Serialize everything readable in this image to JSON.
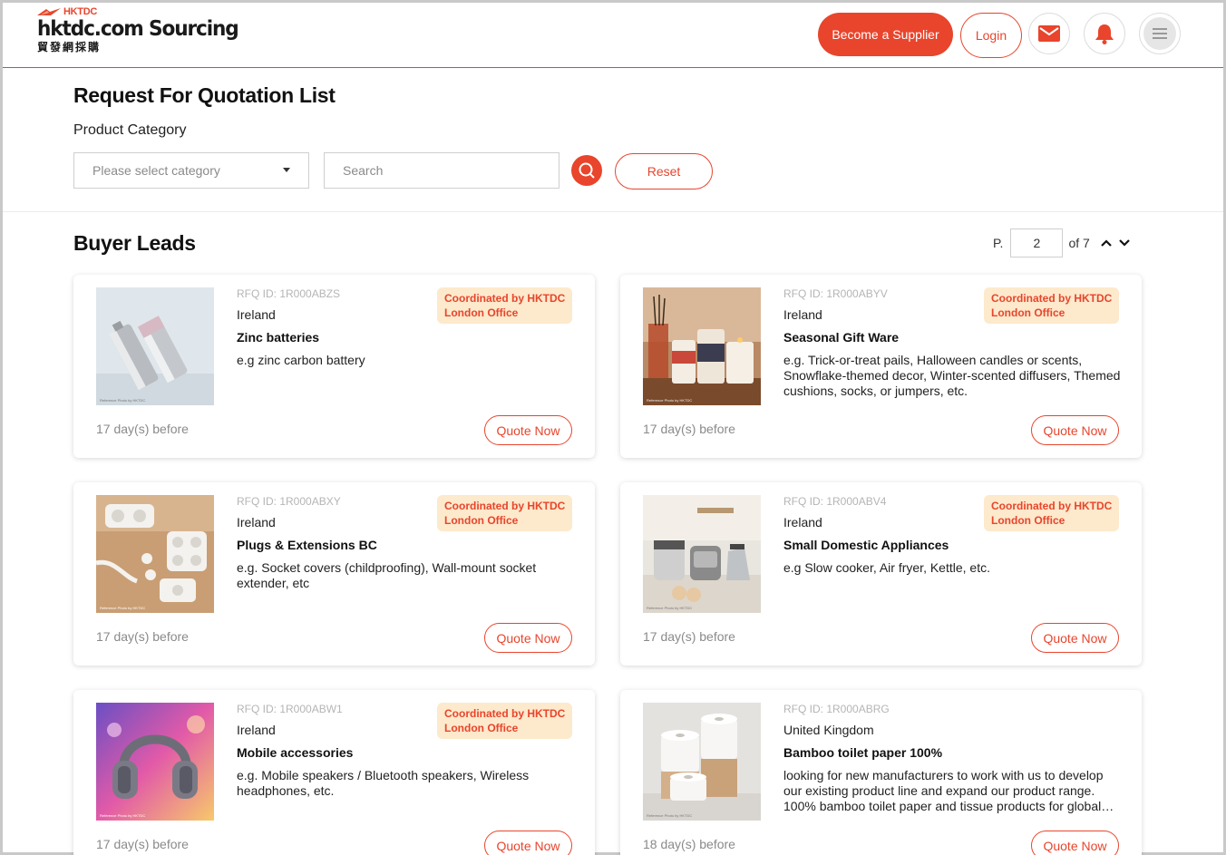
{
  "header": {
    "logo_small": "HKTDC",
    "logo_main": "hktdc.com Sourcing",
    "logo_sub": "貿發網採購",
    "become_supplier_label": "Become a Supplier",
    "login_label": "Login",
    "icons": [
      "mail-icon",
      "bell-icon",
      "menu-icon"
    ]
  },
  "filters": {
    "page_title": "Request For Quotation List",
    "category_label": "Product Category",
    "category_placeholder": "Please select category",
    "search_placeholder": "Search",
    "reset_label": "Reset"
  },
  "leads": {
    "section_title": "Buyer Leads",
    "pager": {
      "prefix": "P.",
      "current": "2",
      "of_text": "of 7"
    },
    "items": [
      {
        "rfq_id": "RFQ ID: 1R000ABZS",
        "country": "Ireland",
        "title": "Zinc batteries",
        "description": "e.g zinc carbon battery",
        "badge_line1": "Coordinated by HKTDC",
        "badge_line2": "London Office",
        "age": "17 day(s) before",
        "quote_label": "Quote Now",
        "image": "battery-photo"
      },
      {
        "rfq_id": "RFQ ID: 1R000ABYV",
        "country": "Ireland",
        "title": "Seasonal Gift Ware",
        "description": "e.g. Trick-or-treat pails, Halloween candles or scents, Snowflake-themed decor, Winter-scented diffusers, Themed cushions, socks, or jumpers, etc.",
        "badge_line1": "Coordinated by HKTDC",
        "badge_line2": "London Office",
        "age": "17 day(s) before",
        "quote_label": "Quote Now",
        "image": "candles-photo"
      },
      {
        "rfq_id": "RFQ ID: 1R000ABXY",
        "country": "Ireland",
        "title": "Plugs & Extensions BC",
        "description": "e.g. Socket covers (childproofing), Wall-mount socket extender, etc",
        "badge_line1": "Coordinated by HKTDC",
        "badge_line2": "London Office",
        "age": "17 day(s) before",
        "quote_label": "Quote Now",
        "image": "plugs-photo"
      },
      {
        "rfq_id": "RFQ ID: 1R000ABV4",
        "country": "Ireland",
        "title": "Small Domestic Appliances",
        "description": "e.g Slow cooker, Air fryer, Kettle, etc.",
        "badge_line1": "Coordinated by HKTDC",
        "badge_line2": "London Office",
        "age": "17 day(s) before",
        "quote_label": "Quote Now",
        "image": "appliances-photo"
      },
      {
        "rfq_id": "RFQ ID: 1R000ABW1",
        "country": "Ireland",
        "title": "Mobile accessories",
        "description": "e.g. Mobile speakers / Bluetooth speakers, Wireless headphones, etc.",
        "badge_line1": "Coordinated by HKTDC",
        "badge_line2": "London Office",
        "age": "17 day(s) before",
        "quote_label": "Quote Now",
        "image": "headphones-photo"
      },
      {
        "rfq_id": "RFQ ID: 1R000ABRG",
        "country": "United Kingdom",
        "title": "Bamboo toilet paper 100%",
        "description": "looking for new manufacturers to work with us to develop our existing product line and expand our product range. 100% bamboo toilet paper and tissue products for global…",
        "badge_line1": "",
        "badge_line2": "",
        "age": "18 day(s) before",
        "quote_label": "Quote Now",
        "image": "toilet-paper-photo"
      }
    ]
  },
  "colors": {
    "accent": "#e8452c",
    "badge_bg": "#fde9cc"
  }
}
